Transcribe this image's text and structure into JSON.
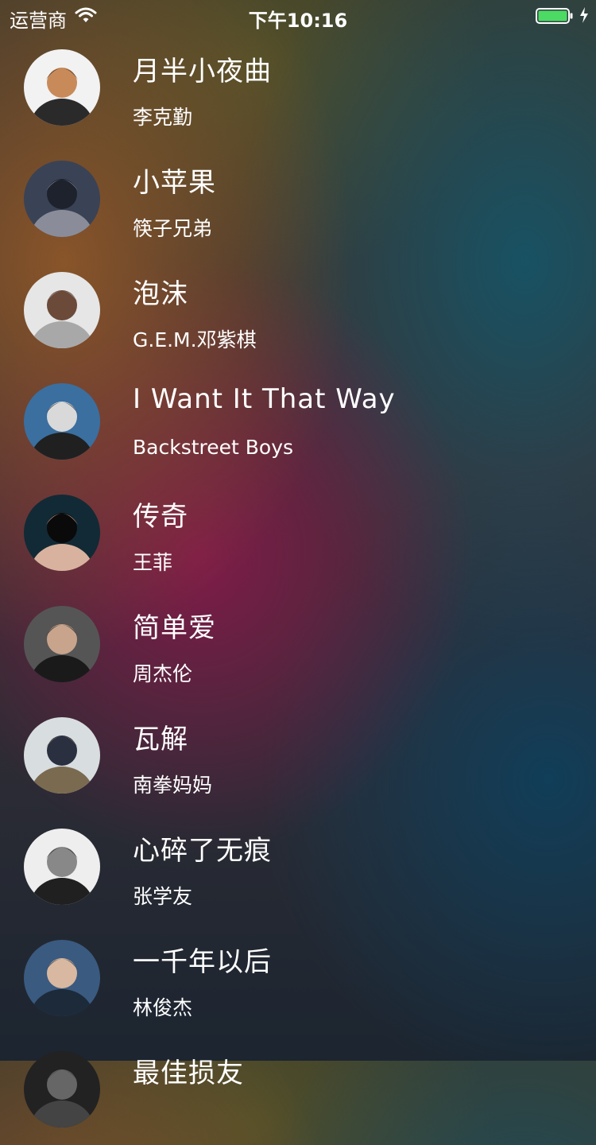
{
  "status_bar": {
    "carrier": "运营商",
    "time": "下午10:16",
    "wifi_icon": "wifi-icon",
    "battery_icon": "battery-icon",
    "battery_level": 1.0,
    "battery_color": "#4cd964"
  },
  "songs": [
    {
      "title": "月半小夜曲",
      "artist": "李克勤",
      "avatar_colors": [
        "#f2f2f2",
        "#2a2a2a",
        "#c98a5a"
      ]
    },
    {
      "title": "小苹果",
      "artist": "筷子兄弟",
      "avatar_colors": [
        "#3a4255",
        "#8a8d99",
        "#1e222c"
      ]
    },
    {
      "title": "泡沫",
      "artist": "G.E.M.邓紫棋",
      "avatar_colors": [
        "#e6e6e6",
        "#a8a8a8",
        "#6b4a3a"
      ]
    },
    {
      "title": "I Want It That Way",
      "artist": "Backstreet Boys",
      "avatar_colors": [
        "#3a6fa0",
        "#202020",
        "#d9d9d9"
      ]
    },
    {
      "title": "传奇",
      "artist": "王菲",
      "avatar_colors": [
        "#122a35",
        "#d8b29e",
        "#0a0a0a"
      ]
    },
    {
      "title": "简单爱",
      "artist": "周杰伦",
      "avatar_colors": [
        "#555555",
        "#1a1a1a",
        "#c8a48c"
      ]
    },
    {
      "title": "瓦解",
      "artist": "南拳妈妈",
      "avatar_colors": [
        "#d8dde0",
        "#7a6a50",
        "#2a3040"
      ]
    },
    {
      "title": "心碎了无痕",
      "artist": "张学友",
      "avatar_colors": [
        "#eeeeee",
        "#202020",
        "#888888"
      ]
    },
    {
      "title": "一千年以后",
      "artist": "林俊杰",
      "avatar_colors": [
        "#3a5a80",
        "#1c2a3a",
        "#d8b8a0"
      ]
    },
    {
      "title": "最佳损友",
      "artist": "",
      "avatar_colors": [
        "#222222",
        "#444444",
        "#666666"
      ]
    }
  ]
}
